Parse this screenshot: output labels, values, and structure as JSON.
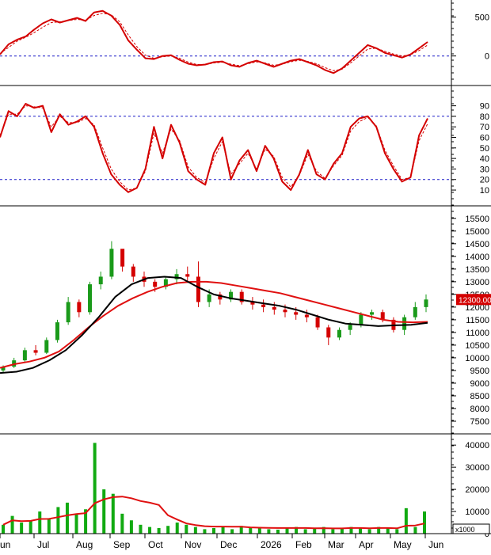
{
  "price_label": "12300.00",
  "volume_multiplier": "x1000",
  "colors": {
    "background": "#ffffff",
    "frame": "#000000",
    "reference_line": "#1c1cc8",
    "indicator": "#d40000",
    "ma_long": "#e01010",
    "ma_short": "#000000",
    "up_candle": "#1a9a1a",
    "down_candle": "#d40000",
    "volume_bar": "#11aa11",
    "price_badge": "#d40000",
    "price_badge_text": "#ffffff"
  },
  "chart_data": [
    {
      "type": "line",
      "panel": "momentum",
      "yticks": [
        500,
        0
      ],
      "ylim": [
        -380,
        720
      ],
      "reference_lines": [
        0
      ],
      "series": [
        {
          "role": "indicator",
          "values": [
            20,
            150,
            210,
            250,
            340,
            420,
            470,
            430,
            460,
            490,
            450,
            560,
            580,
            520,
            400,
            200,
            80,
            -30,
            -40,
            0,
            10,
            -50,
            -100,
            -120,
            -110,
            -80,
            -70,
            -120,
            -140,
            -90,
            -60,
            -100,
            -140,
            -100,
            -60,
            -40,
            -80,
            -120,
            -180,
            -220,
            -160,
            -60,
            40,
            140,
            100,
            40,
            10,
            -20,
            20,
            100,
            180
          ]
        },
        {
          "role": "signal",
          "values": [
            30,
            110,
            190,
            240,
            300,
            370,
            430,
            440,
            455,
            470,
            460,
            520,
            550,
            530,
            440,
            270,
            120,
            10,
            -30,
            -10,
            0,
            -30,
            -80,
            -110,
            -110,
            -90,
            -80,
            -105,
            -125,
            -100,
            -75,
            -90,
            -120,
            -105,
            -75,
            -55,
            -70,
            -100,
            -150,
            -190,
            -170,
            -90,
            0,
            90,
            100,
            60,
            25,
            0,
            15,
            70,
            140
          ]
        }
      ]
    },
    {
      "type": "line",
      "panel": "oscillator",
      "yticks": [
        90,
        80,
        70,
        60,
        50,
        40,
        30,
        20,
        10
      ],
      "ylim": [
        -5,
        107
      ],
      "reference_lines": [
        80,
        20
      ],
      "series": [
        {
          "role": "indicator",
          "values": [
            60,
            85,
            80,
            92,
            88,
            90,
            65,
            82,
            72,
            75,
            80,
            70,
            45,
            25,
            15,
            8,
            12,
            30,
            70,
            40,
            72,
            55,
            28,
            20,
            15,
            45,
            60,
            20,
            38,
            48,
            28,
            52,
            40,
            18,
            10,
            25,
            48,
            25,
            20,
            35,
            45,
            70,
            78,
            80,
            70,
            45,
            30,
            18,
            22,
            62,
            78
          ]
        },
        {
          "role": "signal",
          "values": [
            62,
            82,
            82,
            90,
            89,
            88,
            70,
            80,
            74,
            74,
            78,
            72,
            50,
            30,
            18,
            10,
            12,
            28,
            64,
            45,
            68,
            57,
            32,
            22,
            17,
            40,
            56,
            25,
            35,
            45,
            30,
            49,
            42,
            22,
            13,
            24,
            44,
            28,
            21,
            33,
            43,
            66,
            75,
            79,
            71,
            48,
            33,
            20,
            22,
            57,
            73
          ]
        }
      ]
    },
    {
      "type": "candlestick",
      "panel": "price",
      "yticks": [
        15500,
        15000,
        14500,
        14000,
        13500,
        13000,
        12500,
        12000,
        11500,
        11000,
        10500,
        10000,
        9500,
        9000,
        8500,
        8000,
        7500
      ],
      "ylim": [
        7000,
        15900
      ],
      "last_price": 12300,
      "candles": [
        [
          9500,
          9700,
          9400,
          9650
        ],
        [
          9650,
          10000,
          9600,
          9900
        ],
        [
          9900,
          10400,
          9850,
          10300
        ],
        [
          10300,
          10500,
          10100,
          10200
        ],
        [
          10200,
          10800,
          10150,
          10700
        ],
        [
          10700,
          11500,
          10600,
          11400
        ],
        [
          11400,
          12400,
          11300,
          12200
        ],
        [
          12200,
          12300,
          11600,
          11800
        ],
        [
          11800,
          13000,
          11700,
          12900
        ],
        [
          12900,
          13400,
          12700,
          13200
        ],
        [
          13200,
          14600,
          13100,
          14300
        ],
        [
          14300,
          14200,
          13400,
          13600
        ],
        [
          13600,
          13700,
          13000,
          13200
        ],
        [
          13200,
          13400,
          12800,
          13000
        ],
        [
          13000,
          13100,
          12600,
          12800
        ],
        [
          12800,
          13200,
          12700,
          13100
        ],
        [
          13100,
          13500,
          12900,
          13300
        ],
        [
          13300,
          13600,
          13000,
          13200
        ],
        [
          13200,
          13800,
          12000,
          12200
        ],
        [
          12200,
          12700,
          12000,
          12500
        ],
        [
          12500,
          12600,
          12100,
          12300
        ],
        [
          12300,
          12700,
          12200,
          12600
        ],
        [
          12600,
          12700,
          12100,
          12200
        ],
        [
          12200,
          12400,
          11900,
          12100
        ],
        [
          12100,
          12300,
          11800,
          12000
        ],
        [
          12000,
          12200,
          11700,
          11900
        ],
        [
          11900,
          12100,
          11600,
          11800
        ],
        [
          11800,
          12000,
          11500,
          11700
        ],
        [
          11700,
          11900,
          11400,
          11600
        ],
        [
          11600,
          11700,
          11100,
          11200
        ],
        [
          11200,
          11300,
          10500,
          10800
        ],
        [
          10800,
          11200,
          10700,
          11100
        ],
        [
          11100,
          11400,
          10900,
          11300
        ],
        [
          11300,
          11800,
          11200,
          11700
        ],
        [
          11700,
          11900,
          11500,
          11800
        ],
        [
          11800,
          11900,
          11400,
          11500
        ],
        [
          11500,
          11600,
          11000,
          11100
        ],
        [
          11100,
          11700,
          10900,
          11600
        ],
        [
          11600,
          12200,
          11500,
          12000
        ],
        [
          12000,
          12500,
          11800,
          12300
        ]
      ],
      "series": [
        {
          "role": "ma_long",
          "values": [
            9600,
            9750,
            9850,
            10000,
            10250,
            10700,
            11200,
            11650,
            12050,
            12350,
            12600,
            12800,
            12950,
            13000,
            13000,
            12950,
            12850,
            12750,
            12650,
            12550,
            12400,
            12250,
            12100,
            11950,
            11800,
            11650,
            11500,
            11420,
            11400,
            11420
          ]
        },
        {
          "role": "ma_short",
          "values": [
            9400,
            9450,
            9600,
            9900,
            10300,
            10900,
            11600,
            12400,
            12900,
            13150,
            13200,
            13150,
            12800,
            12500,
            12350,
            12250,
            12150,
            12050,
            11900,
            11700,
            11500,
            11350,
            11300,
            11250,
            11280,
            11300,
            11380
          ]
        }
      ]
    },
    {
      "type": "bar",
      "panel": "volume",
      "yticks": [
        40000,
        30000,
        20000,
        10000,
        0
      ],
      "ylim": [
        0,
        44000
      ],
      "values": [
        4000,
        8000,
        5000,
        6000,
        10000,
        7000,
        12000,
        14000,
        9000,
        11000,
        41000,
        20000,
        18000,
        9000,
        6000,
        4000,
        3000,
        2500,
        3500,
        5000,
        4000,
        3000,
        2000,
        2500,
        3000,
        2000,
        3500,
        2500,
        3000,
        2000,
        1800,
        2500,
        3000,
        2000,
        2500,
        3000,
        2000,
        2200,
        3000,
        2500,
        2000,
        3000,
        2500,
        2000,
        11500,
        3000,
        10000
      ]
    }
  ],
  "x_axis": {
    "labels": [
      "Jun",
      "Jul",
      "Aug",
      "Sep",
      "Oct",
      "Nov",
      "Dec",
      "2026",
      "Feb",
      "Mar",
      "Apr",
      "May",
      "Jun"
    ]
  }
}
